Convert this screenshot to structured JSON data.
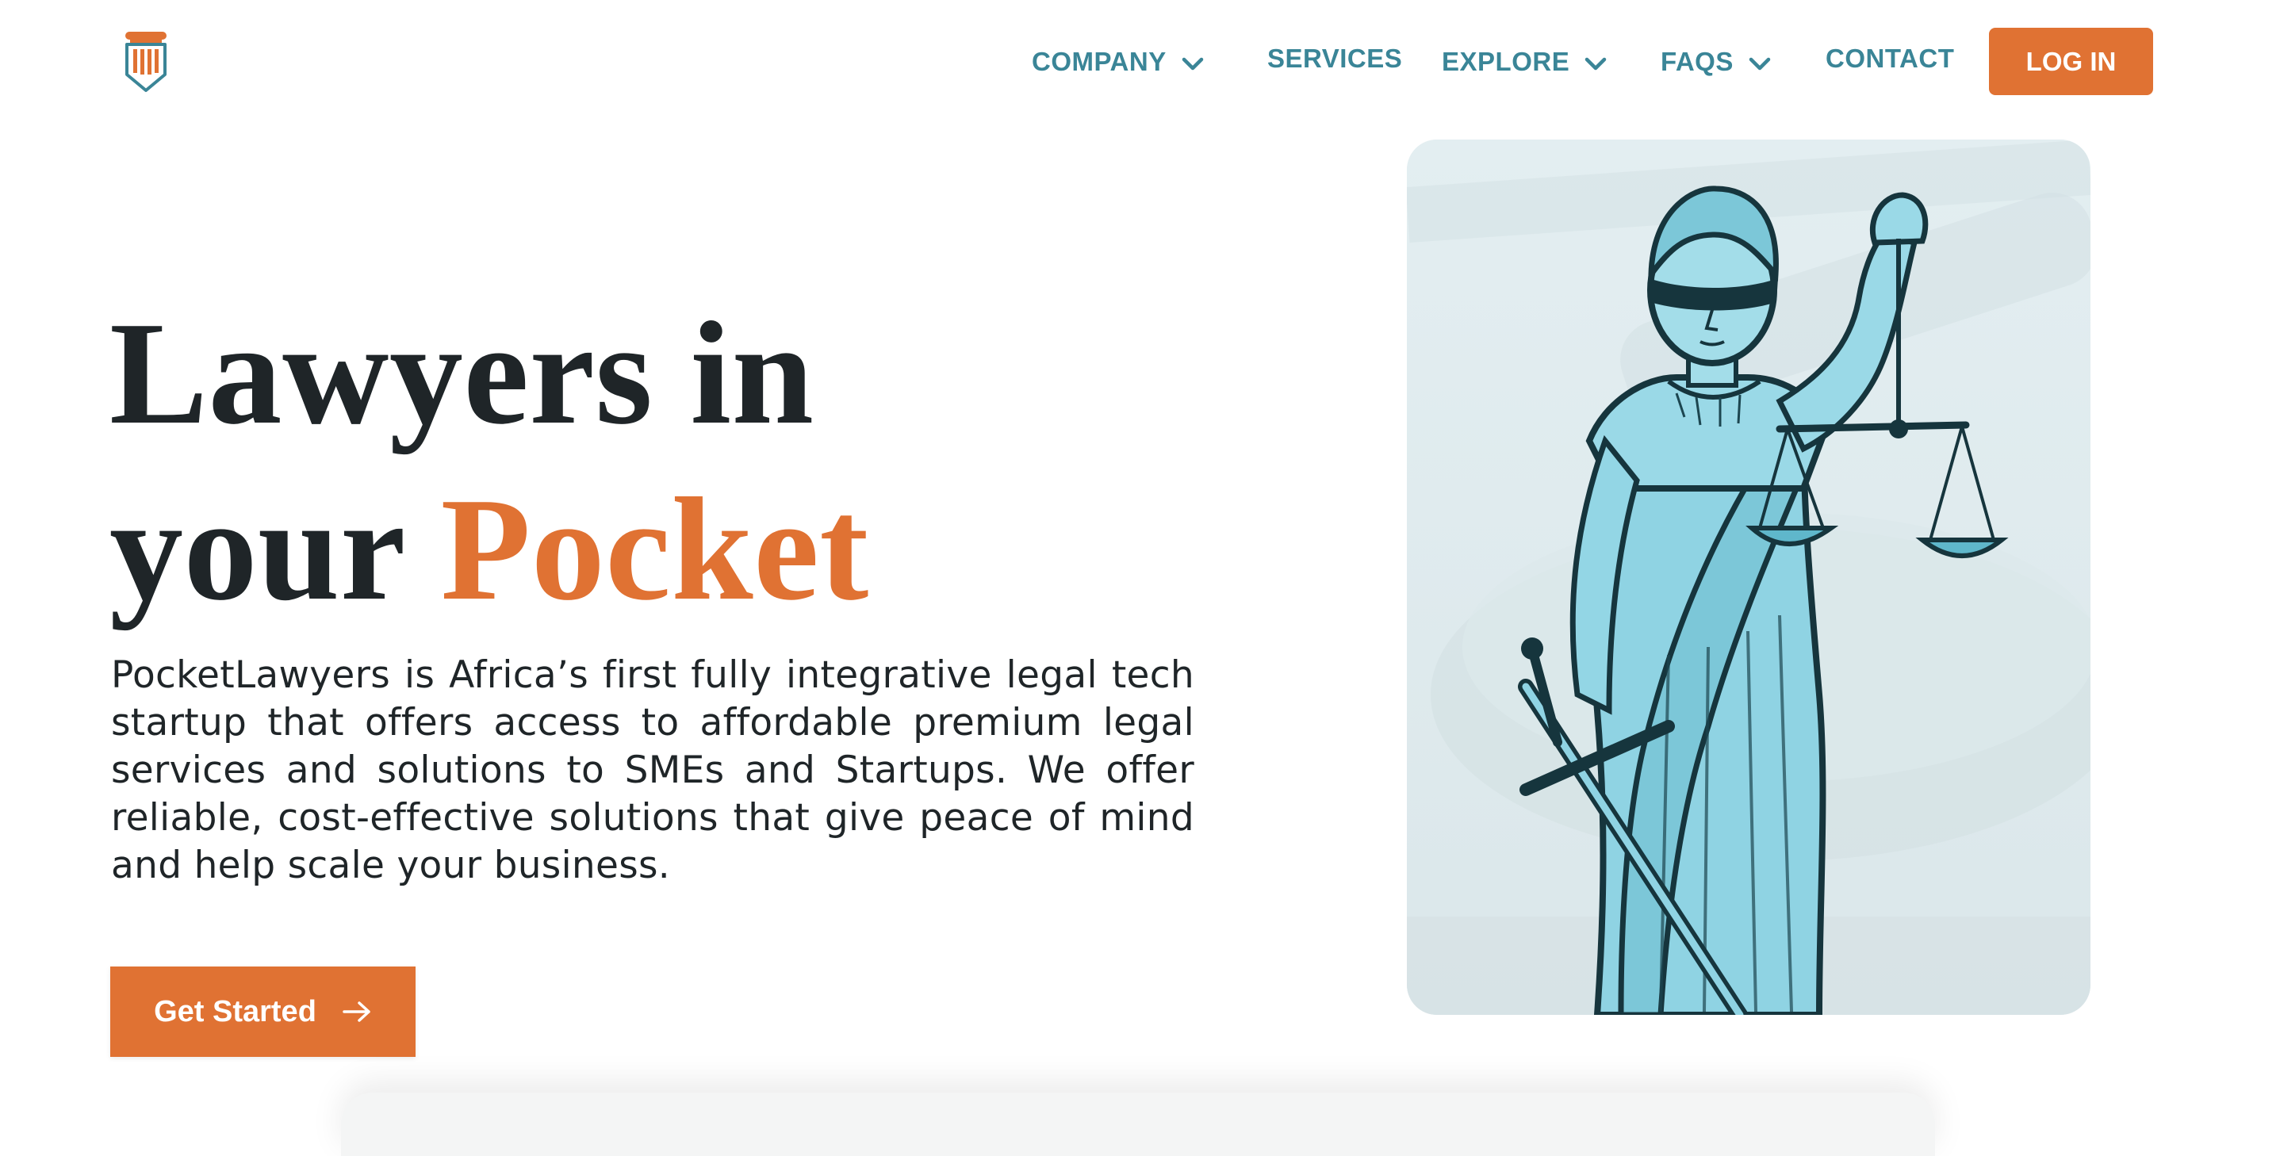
{
  "brand": {
    "logo_icon": "pillar-shield-icon",
    "accent_color": "#e07233",
    "nav_color": "#3a8597",
    "text_color": "#1f2528"
  },
  "nav": {
    "items": [
      {
        "label": "COMPANY",
        "has_dropdown": true
      },
      {
        "label": "SERVICES",
        "has_dropdown": false
      },
      {
        "label": "EXPLORE",
        "has_dropdown": true
      },
      {
        "label": "FAQS",
        "has_dropdown": true
      },
      {
        "label": "CONTACT",
        "has_dropdown": false
      }
    ],
    "login_label": "LOG IN"
  },
  "hero": {
    "title_line1": "Lawyers in",
    "title_line2_plain": "your",
    "title_line2_accent": "Pocket",
    "description": "PocketLawyers is Africa’s first fully integrative legal tech startup that offers access to affordable premium legal services and solutions to SMEs and Startups. We offer reliable, cost-effective solutions that give peace of mind and help scale your business.",
    "cta_label": "Get Started",
    "cta_icon": "arrow-right-icon",
    "image_icon": "lady-justice-illustration"
  }
}
